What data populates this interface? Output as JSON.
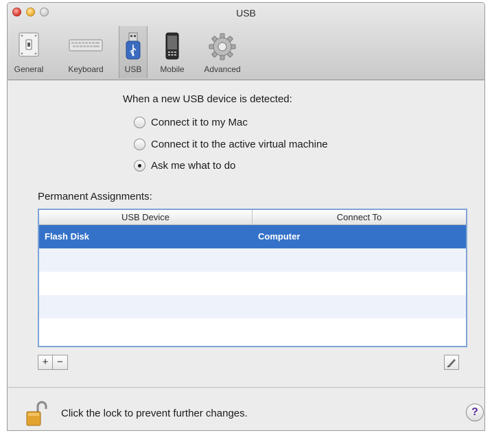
{
  "window": {
    "title": "USB"
  },
  "toolbar": {
    "items": [
      {
        "label": "General",
        "icon": "general-switch-icon"
      },
      {
        "label": "Keyboard",
        "icon": "keyboard-icon"
      },
      {
        "label": "USB",
        "icon": "usb-icon",
        "selected": true
      },
      {
        "label": "Mobile",
        "icon": "mobile-icon"
      },
      {
        "label": "Advanced",
        "icon": "gear-icon"
      }
    ]
  },
  "usb_detect": {
    "heading": "When a new USB device is detected:",
    "options": [
      {
        "label": "Connect it to my Mac",
        "checked": false
      },
      {
        "label": "Connect it to the active virtual machine",
        "checked": false
      },
      {
        "label": "Ask me what to do",
        "checked": true
      }
    ]
  },
  "assignments": {
    "label": "Permanent Assignments:",
    "columns": [
      "USB Device",
      "Connect To"
    ],
    "rows": [
      [
        "Flash Disk",
        "Computer"
      ]
    ]
  },
  "buttons": {
    "add": "+",
    "remove": "−"
  },
  "footer": {
    "lock_text": "Click the lock to prevent further changes.",
    "help": "?"
  },
  "colors": {
    "selection": "#3472c9",
    "table_border": "#7fa4d6"
  }
}
